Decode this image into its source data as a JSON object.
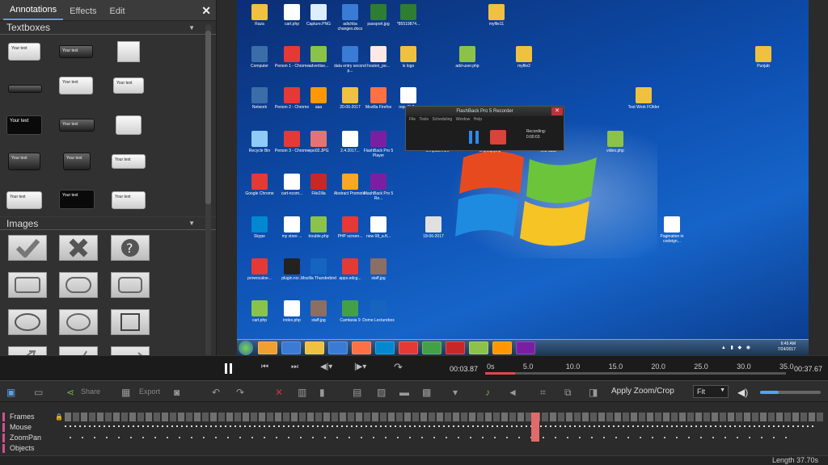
{
  "left_panel": {
    "tabs": [
      {
        "label": "Annotations",
        "active": true
      },
      {
        "label": "Effects"
      },
      {
        "label": "Edit"
      }
    ],
    "close_glyph": "✕",
    "sections": {
      "textboxes": "Textboxes",
      "images": "Images"
    },
    "textbox_samples": [
      "Your text",
      "Your text",
      "Your text",
      "Your text",
      "Your text",
      "Your text",
      "Your text",
      "Your text",
      "Your text",
      "Your text",
      "Your text",
      "Your text",
      "Your text",
      "Your text",
      "Your text"
    ]
  },
  "recorded_screen": {
    "desktop_icons": [
      "Raza",
      "cart.php",
      "Capture.PNG",
      "adichba changes.docx",
      "passport.jpg",
      "*85519874...",
      "myfile11",
      "Computer",
      "Person 1 - Chrome",
      "advertise...",
      "data entry second p...",
      "houten_pe...",
      "ls logo",
      "add-user.php",
      "myfile2",
      "Punjab",
      "Network",
      "Person 2 - Chrome",
      "aaa",
      "20-06-2017",
      "Mozilla Firefox",
      "repo/lib2...",
      "Test Work FOlder",
      "Recycle Bin",
      "Person 3 - Chrome",
      "epo02.JPG",
      "2.4.2017...",
      "FlashBack Pro 5 Player",
      "template.ntm",
      "chipsup.php",
      "find data",
      "video.php",
      "Google Chrome",
      "cart-ncom...",
      "FileZilla",
      "Abstract Promoter",
      "FlashBack Pro 5 Re...",
      "Skype",
      "my store ...",
      "trouble.php",
      "PHP screen...",
      "new 08_a.ft...",
      "18-06-2017",
      "Pagination in codeign...",
      "prowocaloe...",
      "plugin.ncr...",
      "Mozilla Thunderbird",
      "apps.edcg...",
      "staff.jpg",
      "cart.php",
      "index.php",
      "staff.jpg",
      "Camtasia 9",
      "Dome Lecturebox"
    ],
    "clock": {
      "time": "6:45 AM",
      "date": "7/24/2017"
    },
    "recorder": {
      "title": "FlashBack Pro 5 Recorder",
      "menu": [
        "File",
        "Tools",
        "Scheduling",
        "Window",
        "Help"
      ],
      "status": "Recording:",
      "time": "0:00:03"
    }
  },
  "player": {
    "current_time": "00:03.87",
    "end_time": "00:37.67",
    "scale": [
      "0s",
      "5.0",
      "10.0",
      "15.0",
      "20.0",
      "25.0",
      "30.0",
      "35.0"
    ],
    "progress_fraction": 0.1
  },
  "toolbar": {
    "share": "Share",
    "export": "Export",
    "apply_zoom": "Apply Zoom/Crop",
    "fit": "Fit",
    "volume_fraction": 0.3
  },
  "tracks": [
    "Frames",
    "Mouse",
    "ZoomPan",
    "Objects"
  ],
  "status": {
    "length": "Length 37.70s"
  }
}
